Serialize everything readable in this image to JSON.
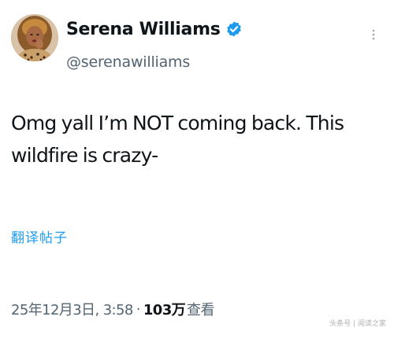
{
  "author": {
    "display_name": "Serena Williams",
    "handle": "@serenawilliams",
    "verified": true,
    "verified_color": "#1d9bf0"
  },
  "tweet": {
    "text": "Omg yall I’m NOT coming back. This wildfire is crazy-",
    "translate_label": "翻译帖子",
    "timestamp": "25年12月3日, 3:58",
    "separator": "·",
    "views_count": "103万",
    "views_label": "查看"
  },
  "watermark": {
    "text": "头条号 | 阅读之家"
  },
  "icons": {
    "avatar": "avatar-photo",
    "verified": "verified-badge-icon",
    "more": "more-options-icon"
  },
  "colors": {
    "text_primary": "#0f1419",
    "text_secondary": "#536471",
    "link": "#1d9bf0"
  }
}
